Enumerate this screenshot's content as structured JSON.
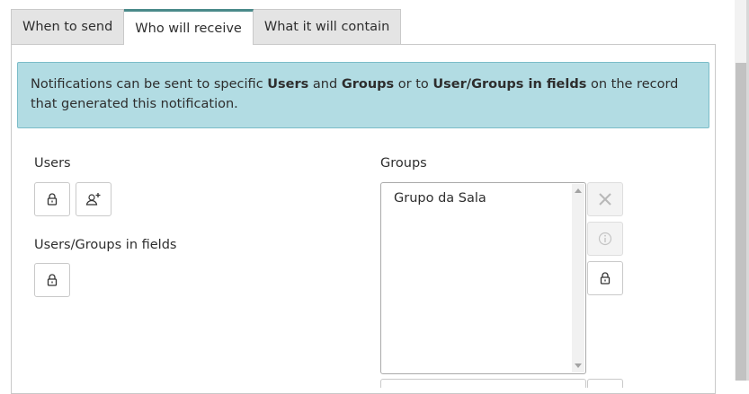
{
  "tabs": [
    {
      "label": "When to send",
      "active": false
    },
    {
      "label": "Who will receive",
      "active": true
    },
    {
      "label": "What it will contain",
      "active": false
    }
  ],
  "info": {
    "part1": "Notifications can be sent to specific ",
    "users": "Users",
    "and": " and ",
    "groups": "Groups",
    "or_to": " or to ",
    "fields": "User/Groups in fields",
    "part2": " on the record that generated this notification."
  },
  "users": {
    "label": "Users",
    "lock_icon": "lock-icon",
    "add_icon": "add-user-icon"
  },
  "fields": {
    "label": "Users/Groups in fields",
    "lock_icon": "lock-icon"
  },
  "groups": {
    "label": "Groups",
    "items": [
      "Grupo da Sala"
    ],
    "remove_icon": "close-icon",
    "info_icon": "info-icon",
    "lock_icon": "lock-icon"
  },
  "colors": {
    "info_bg": "#b2dce3",
    "info_border": "#7bbcc8",
    "tab_bg": "#e4e4e4"
  }
}
